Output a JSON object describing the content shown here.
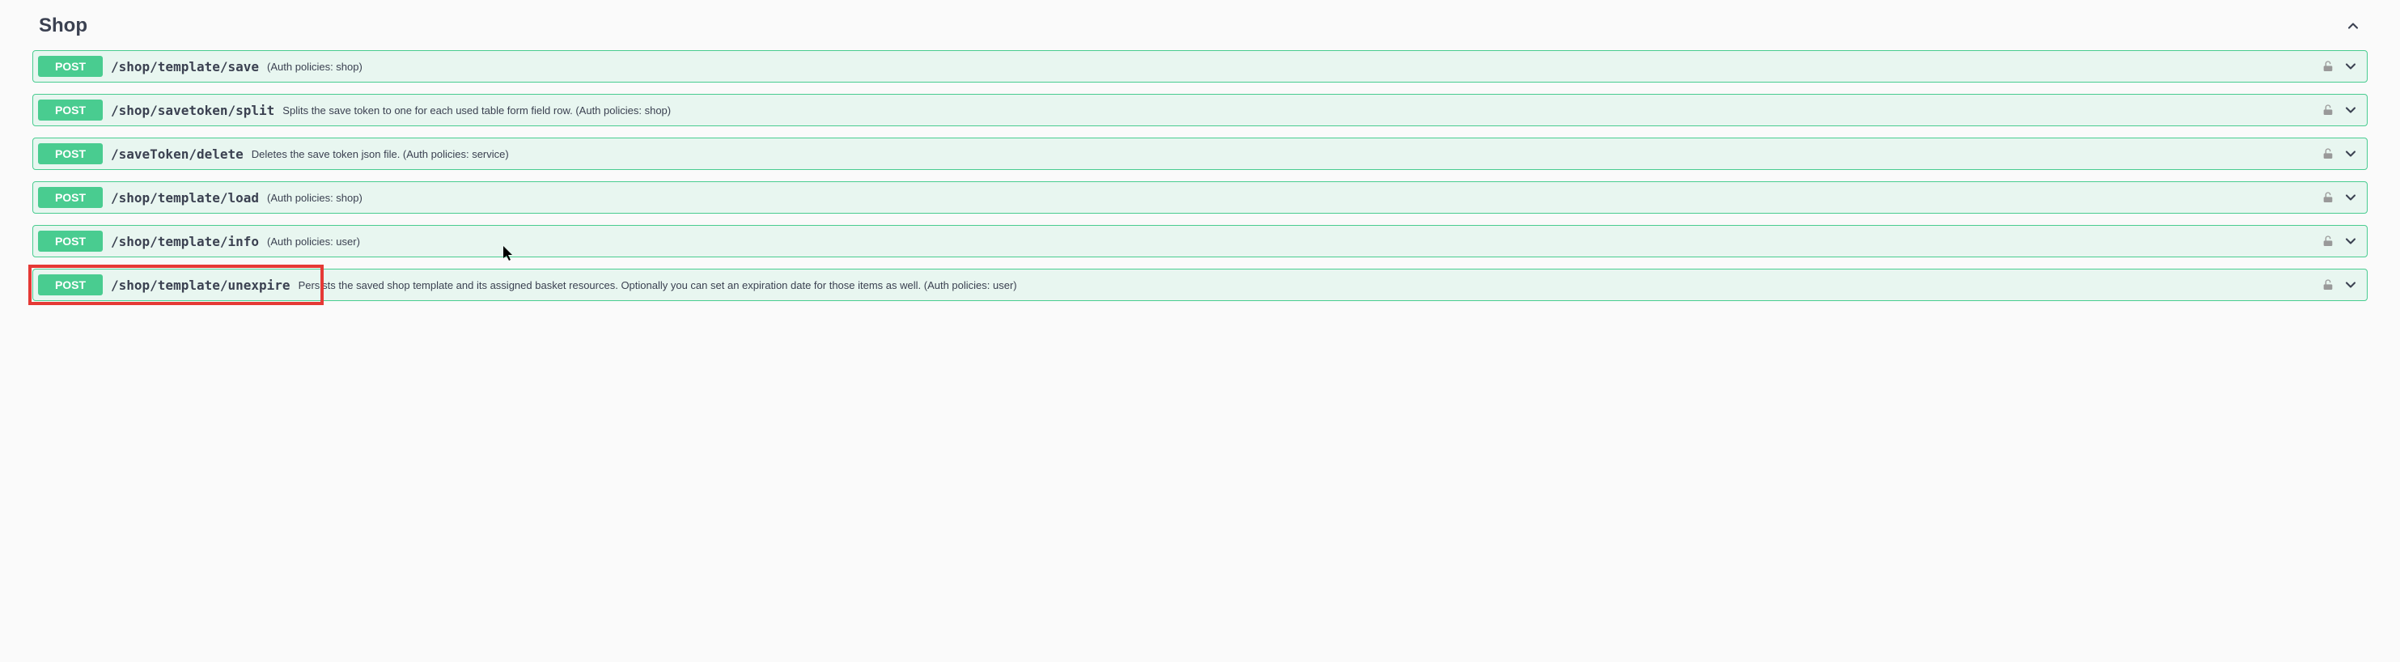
{
  "section": {
    "title": "Shop"
  },
  "endpoints": [
    {
      "method": "POST",
      "path": "/shop/template/save",
      "description": "(Auth policies: shop)",
      "highlighted": false
    },
    {
      "method": "POST",
      "path": "/shop/savetoken/split",
      "description": "Splits the save token to one for each used table form field row. (Auth policies: shop)",
      "highlighted": false
    },
    {
      "method": "POST",
      "path": "/saveToken/delete",
      "description": "Deletes the save token json file. (Auth policies: service)",
      "highlighted": false
    },
    {
      "method": "POST",
      "path": "/shop/template/load",
      "description": "(Auth policies: shop)",
      "highlighted": false
    },
    {
      "method": "POST",
      "path": "/shop/template/info",
      "description": "(Auth policies: user)",
      "highlighted": false
    },
    {
      "method": "POST",
      "path": "/shop/template/unexpire",
      "description": "Persists the saved shop template and its assigned basket resources. Optionally you can set an expiration date for those items as well. (Auth policies: user)",
      "highlighted": true
    }
  ]
}
